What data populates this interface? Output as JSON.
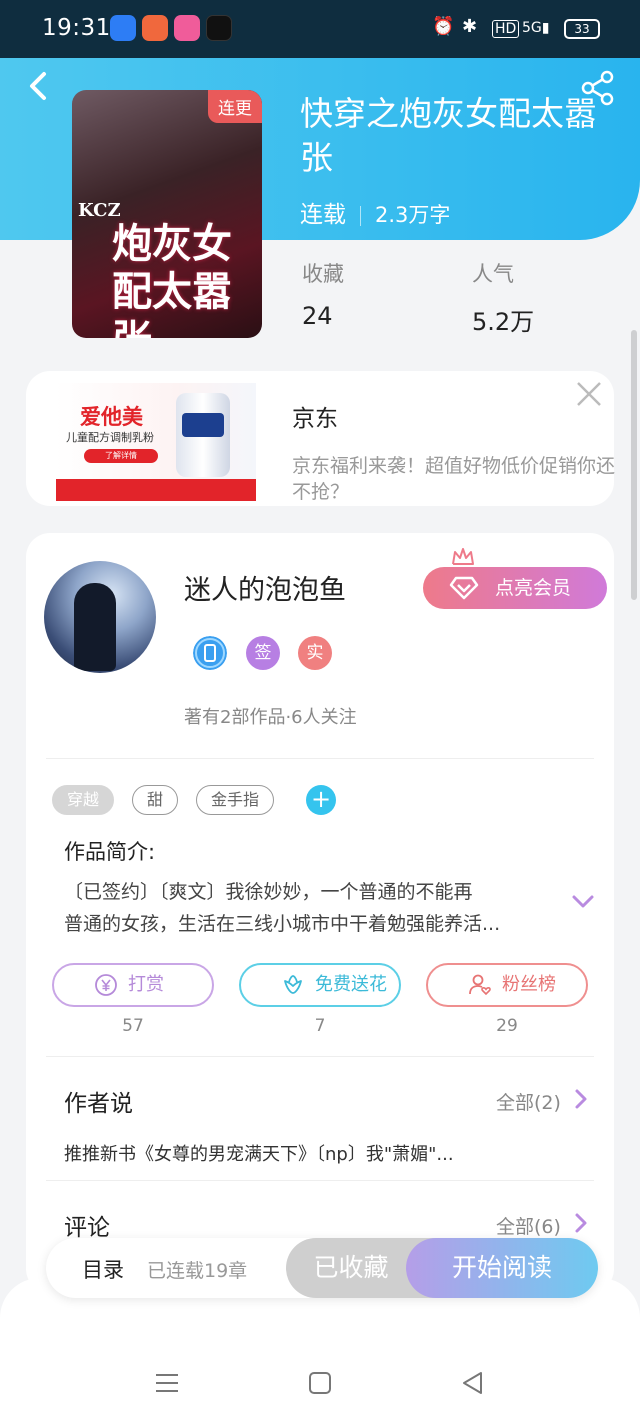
{
  "status_bar": {
    "time": "19:31",
    "battery": "33"
  },
  "book": {
    "cover_badge": "连更",
    "cover_kcz": "KCZ",
    "cover_title": "炮灰女配太嚣张",
    "title": "快穿之炮灰女配太嚣张",
    "status": "连载",
    "word_count": "2.3万字",
    "stats": [
      {
        "label": "收藏",
        "value": "24"
      },
      {
        "label": "人气",
        "value": "5.2万"
      }
    ]
  },
  "ad": {
    "image_brand": "爱他美",
    "image_sub": "儿童配方调制乳粉",
    "image_button": "了解详情",
    "title": "京东",
    "description": "京东福利来袭！超值好物低价促销你还不抢？"
  },
  "author": {
    "name": "迷人的泡泡鱼",
    "vip_button": "点亮会员",
    "badges": [
      "签",
      "实"
    ],
    "works_info": "著有2部作品·6人关注"
  },
  "tags": [
    "穿越",
    "甜",
    "金手指"
  ],
  "intro": {
    "heading": "作品简介:",
    "line1": "〔已签约〕〔爽文〕我徐妙妙，一个普通的不能再",
    "line2": "普通的女孩，生活在三线小城市中干着勉强能养活..."
  },
  "actions": [
    {
      "label": "打赏",
      "count": "57",
      "color": "#c9a6e6"
    },
    {
      "label": "免费送花",
      "count": "7",
      "color": "#5ccfe6"
    },
    {
      "label": "粉丝榜",
      "count": "29",
      "color": "#ef8f8f"
    }
  ],
  "author_says": {
    "title": "作者说",
    "more": "全部(2)",
    "text": "推推新书《女尊的男宠满天下》〔np〕我\"萧媚\"..."
  },
  "comments": {
    "title": "评论",
    "more": "全部(6)"
  },
  "bottom_bar": {
    "toc": "目录",
    "chapters": "已连载19章",
    "collected": "已收藏",
    "read": "开始阅读"
  }
}
